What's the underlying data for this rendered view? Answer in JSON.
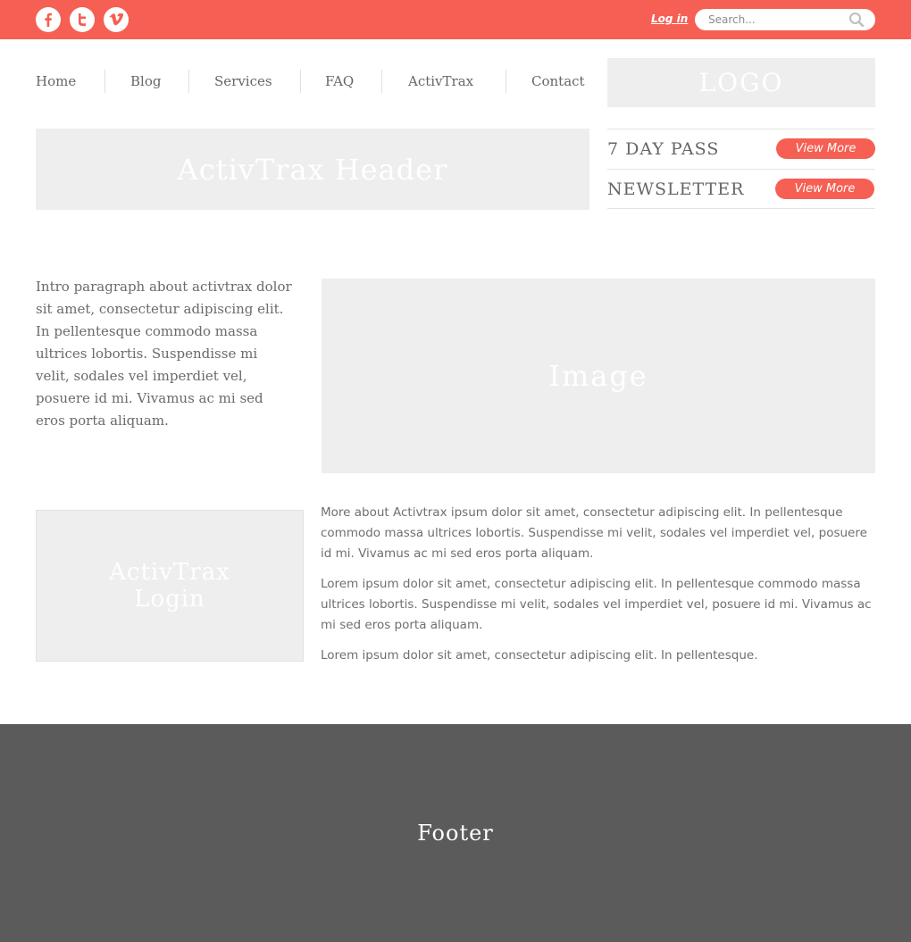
{
  "topbar": {
    "social_icons": [
      "facebook-icon",
      "twitter-icon",
      "vimeo-icon"
    ],
    "login_label": "Log in",
    "search_placeholder": "Search..."
  },
  "nav": {
    "items": [
      "Home",
      "Blog",
      "Services",
      "FAQ",
      "ActivTrax",
      "Contact"
    ]
  },
  "logo": "LOGO",
  "header": "ActivTrax Header",
  "promos": [
    {
      "label": "7 DAY PASS",
      "button": "View More"
    },
    {
      "label": "NEWSLETTER",
      "button": "View More"
    }
  ],
  "intro": "Intro paragraph about activtrax dolor sit amet, consectetur adipiscing elit. In pellentesque commodo massa ultrices lobortis. Suspendisse mi velit, sodales vel imperdiet vel, posuere id mi. Vivamus ac mi sed eros porta aliquam.",
  "image_label": "Image",
  "login_block": {
    "line1": "ActivTrax",
    "line2": "Login"
  },
  "paragraphs": [
    "More about Activtrax ipsum dolor sit amet, consectetur adipiscing elit. In pellentesque commodo massa ultrices lobortis. Suspendisse mi velit, sodales vel imperdiet vel, posuere id mi. Vivamus ac mi sed eros porta aliquam.",
    "Lorem ipsum dolor sit amet, consectetur adipiscing elit. In pellentesque commodo massa ultrices lobortis. Suspendisse mi velit, sodales vel imperdiet vel, posuere id mi. Vivamus ac mi sed eros porta aliquam.",
    "Lorem ipsum dolor sit amet, consectetur adipiscing elit. In pellentesque."
  ],
  "footer": "Footer",
  "colors": {
    "accent": "#f65f53",
    "placeholder_block": "#eeeeee",
    "footer": "#5b5b5b"
  }
}
